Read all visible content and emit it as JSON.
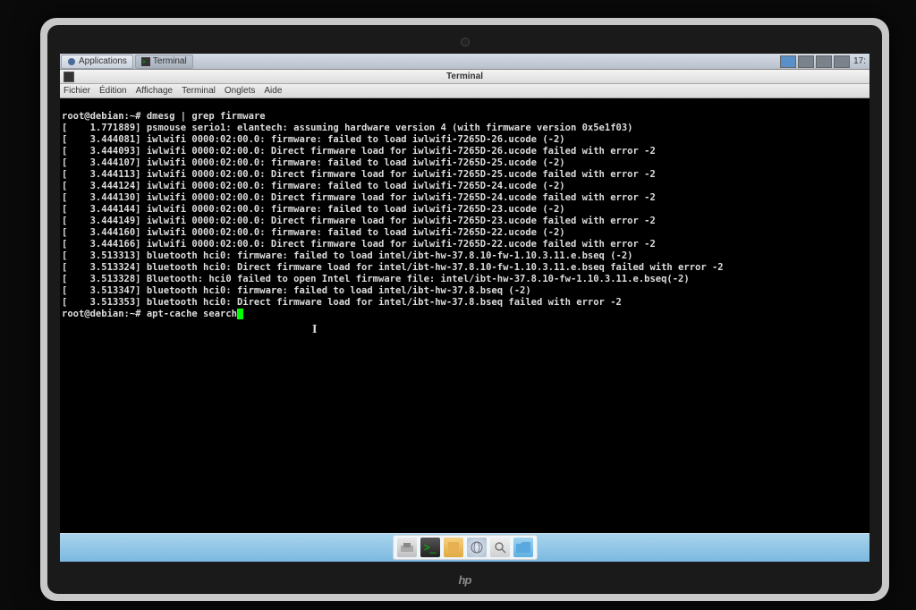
{
  "panel": {
    "applications": "Applications",
    "terminal_task": "Terminal",
    "clock": "17:"
  },
  "window": {
    "title": "Terminal"
  },
  "menubar": {
    "file": "Fichier",
    "edit": "Édition",
    "view": "Affichage",
    "terminal": "Terminal",
    "tabs": "Onglets",
    "help": "Aide"
  },
  "terminal": {
    "prompt1": "root@debian:~#",
    "cmd1": "dmesg | grep firmware",
    "lines": [
      "[    1.771889] psmouse serio1: elantech: assuming hardware version 4 (with firmware version 0x5e1f03)",
      "[    3.444081] iwlwifi 0000:02:00.0: firmware: failed to load iwlwifi-7265D-26.ucode (-2)",
      "[    3.444093] iwlwifi 0000:02:00.0: Direct firmware load for iwlwifi-7265D-26.ucode failed with error -2",
      "[    3.444107] iwlwifi 0000:02:00.0: firmware: failed to load iwlwifi-7265D-25.ucode (-2)",
      "[    3.444113] iwlwifi 0000:02:00.0: Direct firmware load for iwlwifi-7265D-25.ucode failed with error -2",
      "[    3.444124] iwlwifi 0000:02:00.0: firmware: failed to load iwlwifi-7265D-24.ucode (-2)",
      "[    3.444130] iwlwifi 0000:02:00.0: Direct firmware load for iwlwifi-7265D-24.ucode failed with error -2",
      "[    3.444144] iwlwifi 0000:02:00.0: firmware: failed to load iwlwifi-7265D-23.ucode (-2)",
      "[    3.444149] iwlwifi 0000:02:00.0: Direct firmware load for iwlwifi-7265D-23.ucode failed with error -2",
      "[    3.444160] iwlwifi 0000:02:00.0: firmware: failed to load iwlwifi-7265D-22.ucode (-2)",
      "[    3.444166] iwlwifi 0000:02:00.0: Direct firmware load for iwlwifi-7265D-22.ucode failed with error -2",
      "[    3.513313] bluetooth hci0: firmware: failed to load intel/ibt-hw-37.8.10-fw-1.10.3.11.e.bseq (-2)",
      "[    3.513324] bluetooth hci0: Direct firmware load for intel/ibt-hw-37.8.10-fw-1.10.3.11.e.bseq failed with error -2",
      "[    3.513328] Bluetooth: hci0 failed to open Intel firmware file: intel/ibt-hw-37.8.10-fw-1.10.3.11.e.bseq(-2)",
      "[    3.513347] bluetooth hci0: firmware: failed to load intel/ibt-hw-37.8.bseq (-2)",
      "[    3.513353] bluetooth hci0: Direct firmware load for intel/ibt-hw-37.8.bseq failed with error -2"
    ],
    "prompt2": "root@debian:~#",
    "cmd2": "apt-cache search"
  },
  "logo": "hp"
}
